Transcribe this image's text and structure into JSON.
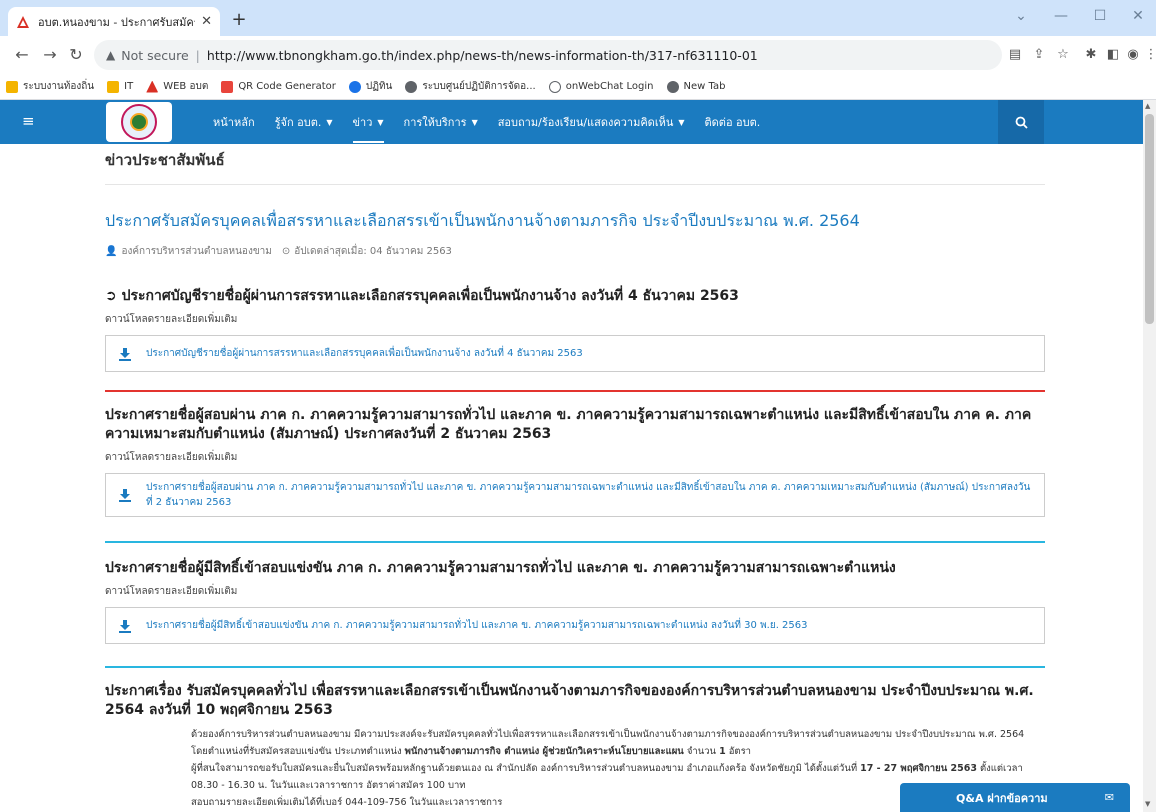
{
  "browser": {
    "tab_title": "อบต.หนองขาม - ประกาศรับสมัครบุคคลเพื่อสรรหา",
    "new_tab": "+",
    "not_secure": "Not secure",
    "url": "http://www.tbnongkham.go.th/index.php/news-th/news-information-th/317-nf631110-01",
    "bookmarks": [
      {
        "label": "ระบบงานท้องถิ่น",
        "color": "#f4b400"
      },
      {
        "label": "IT",
        "color": "#f4b400"
      },
      {
        "label": "WEB อบต",
        "color": "#d93025"
      },
      {
        "label": "QR Code Generator",
        "color": "#e8453c"
      },
      {
        "label": "ปฏิทิน",
        "color": "#1a73e8"
      },
      {
        "label": "ระบบศูนย์ปฏิบัติการจัดอ...",
        "color": "#5f6368"
      },
      {
        "label": "onWebChat Login",
        "color": "#5f6368"
      },
      {
        "label": "New Tab",
        "color": "#5f6368"
      }
    ]
  },
  "nav": {
    "items": [
      {
        "label": "หน้าหลัก",
        "dropdown": false
      },
      {
        "label": "รู้จัก อบต.",
        "dropdown": true
      },
      {
        "label": "ข่าว",
        "dropdown": true
      },
      {
        "label": "การให้บริการ",
        "dropdown": true
      },
      {
        "label": "สอบถาม/ร้องเรียน/แสดงความคิดเห็น",
        "dropdown": true
      },
      {
        "label": "ติดต่อ อบต.",
        "dropdown": false
      }
    ]
  },
  "page": {
    "heading": "ข่าวประชาสัมพันธ์",
    "title": "ประกาศรับสมัครบุคคลเพื่อสรรหาและเลือกสรรเข้าเป็นพนักงานจ้างตามภารกิจ ประจำปีงบประมาณ พ.ศ. 2564",
    "author": "องค์การบริหารส่วนตำบลหนองขาม",
    "updated": "อัปเดตล่าสุดเมื่อ: 04 ธันวาคม 2563"
  },
  "sections": [
    {
      "title": "ประกาศบัญชีรายชื่อผู้ผ่านการสรรหาและเลือกสรรบุคคลเพื่อเป็นพนักงานจ้าง ลงวันที่ 4 ธันวาคม 2563",
      "download_label": "ดาวน์โหลดรายละเอียดเพิ่มเติม",
      "file": "ประกาศบัญชีรายชื่อผู้ผ่านการสรรหาและเลือกสรรบุคคลเพื่อเป็นพนักงานจ้าง ลงวันที่ 4 ธันวาคม 2563"
    },
    {
      "title": "ประกาศรายชื่อผู้สอบผ่าน ภาค ก. ภาคความรู้ความสามารถทั่วไป และภาค ข. ภาคความรู้ความสามารถเฉพาะตำแหน่ง และมีสิทธิ์เข้าสอบใน ภาค ค. ภาคความเหมาะสมกับตำแหน่ง (สัมภาษณ์) ประกาศลงวันที่ 2 ธันวาคม 2563",
      "download_label": "ดาวน์โหลดรายละเอียดเพิ่มเติม",
      "file": "ประกาศรายชื่อผู้สอบผ่าน ภาค ก. ภาคความรู้ความสามารถทั่วไป และภาค ข. ภาคความรู้ความสามารถเฉพาะตำแหน่ง และมีสิทธิ์เข้าสอบใน ภาค ค. ภาคความเหมาะสมกับตำแหน่ง (สัมภาษณ์) ประกาศลงวันที่ 2 ธันวาคม 2563"
    },
    {
      "title": "ประกาศรายชื่อผู้มีสิทธิ์เข้าสอบแข่งขัน ภาค ก. ภาคความรู้ความสามารถทั่วไป และภาค ข. ภาคความรู้ความสามารถเฉพาะตำแหน่ง",
      "download_label": "ดาวน์โหลดรายละเอียดเพิ่มเติม",
      "file": "ประกาศรายชื่อผู้มีสิทธิ์เข้าสอบแข่งขัน ภาค ก. ภาคความรู้ความสามารถทั่วไป และภาค ข. ภาคความรู้ความสามารถเฉพาะตำแหน่ง ลงวันที่ 30 พ.ย. 2563"
    },
    {
      "title": "ประกาศเรื่อง รับสมัครบุคคลทั่วไป เพื่อสรรหาและเลือกสรรเข้าเป็นพนักงานจ้างตามภารกิจขององค์การบริหารส่วนตำบลหนองขาม ประจำปีงบประมาณ พ.ศ. 2564 ลงวันที่ 10 พฤศจิกายน 2563",
      "p1": "ด้วยองค์การบริหารส่วนตำบลหนองขาม มีความประสงค์จะรับสมัครบุคคลทั่วไปเพื่อสรรหาและเลือกสรรเข้าเป็นพนักงานจ้างตามภารกิจขององค์การบริหารส่วนตำบลหนองขาม ประจำปีงบประมาณ พ.ศ. 2564",
      "p2_a": "โดยตำแหน่งที่รับสมัครสอบแข่งขัน ประเภทตำแหน่ง ",
      "p2_b": "พนักงานจ้างตามภารกิจ ตำแหน่ง ผู้ช่วยนักวิเคราะห์นโยบายและแผน",
      "p2_c": " จำนวน ",
      "p2_d": "1",
      "p2_e": " อัตรา",
      "p3_a": "ผู้ที่สนใจสามารถขอรับใบสมัครและยื่นใบสมัครพร้อมหลักฐานด้วยตนเอง ณ สำนักปลัด องค์การบริหารส่วนตำบลหนองขาม อำเภอแก้งคร้อ จังหวัดชัยภูมิ ได้ตั้งแต่วันที่ ",
      "p3_b": "17 - 27 พฤศจิกายน 2563",
      "p3_c": " ตั้งแต่เวลา 08.30 - 16.30 น. ในวันและเวลาราชการ อัตราค่าสมัคร 100 บาท",
      "p4": "สอบถามรายละเอียดเพิ่มเติมได้ที่เบอร์ 044-109-756 ในวันและเวลาราชการ"
    }
  ],
  "qa_button": "Q&A ฝากข้อความ",
  "colors": {
    "brand": "#1b7bc0",
    "divider_red": "#e3342f",
    "divider_cyan": "#29b6e0"
  }
}
